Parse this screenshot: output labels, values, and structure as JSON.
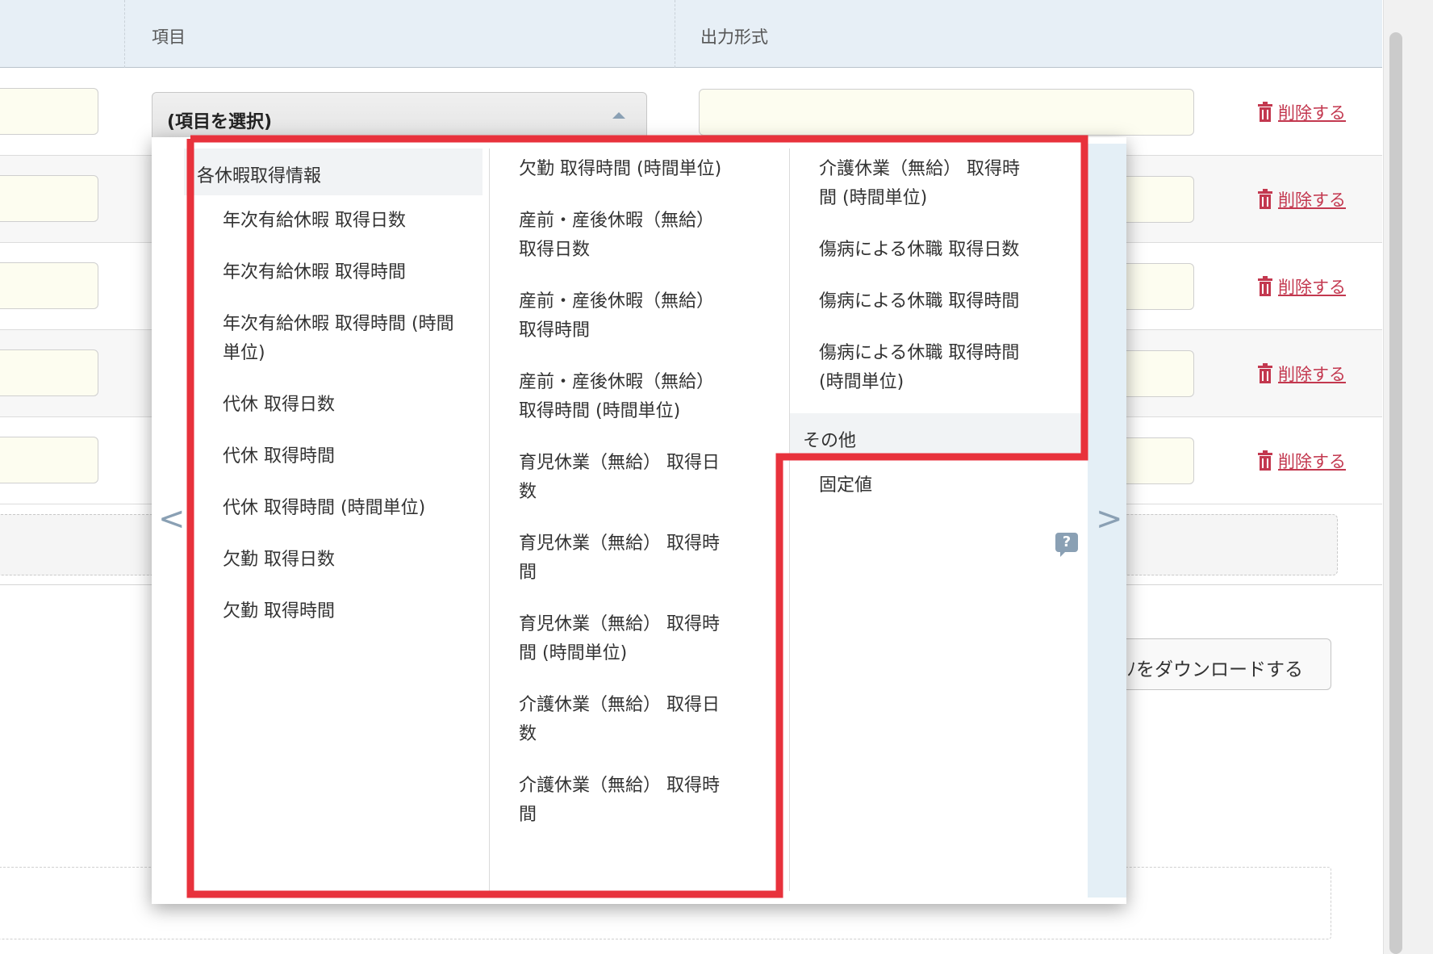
{
  "table_header": {
    "col_item": "項目",
    "col_format": "出力形式"
  },
  "rows": [
    {
      "delete_label": "削除する"
    },
    {
      "delete_label": "削除する"
    },
    {
      "delete_label": "削除する"
    },
    {
      "delete_label": "削除する"
    },
    {
      "delete_label": "削除する"
    }
  ],
  "select": {
    "value": "(項目を選択)"
  },
  "download_button": {
    "label": "ﾉをダウンロードする"
  },
  "dropdown": {
    "nav_prev": "<",
    "nav_next": ">",
    "group1_header": "各休暇取得情報",
    "col1_items": [
      "年次有給休暇 取得日数",
      "年次有給休暇 取得時間",
      "年次有給休暇 取得時間 (時間単位)",
      "代休 取得日数",
      "代休 取得時間",
      "代休 取得時間 (時間単位)",
      "欠勤 取得日数",
      "欠勤 取得時間"
    ],
    "col2_items": [
      "欠勤 取得時間 (時間単位)",
      "産前・産後休暇（無給） 取得日数",
      "産前・産後休暇（無給） 取得時間",
      "産前・産後休暇（無給） 取得時間 (時間単位)",
      "育児休業（無給） 取得日数",
      "育児休業（無給） 取得時間",
      "育児休業（無給） 取得時間 (時間単位)",
      "介護休業（無給） 取得日数",
      "介護休業（無給） 取得時間"
    ],
    "col3_items": [
      "介護休業（無給） 取得時間 (時間単位)",
      "傷病による休職 取得日数",
      "傷病による休職 取得時間",
      "傷病による休職 取得時間 (時間単位)"
    ],
    "group2_header": "その他",
    "group2_items": [
      "固定値"
    ],
    "help_icon_glyph": "?"
  },
  "colors": {
    "annotation": "#e8323c",
    "delete_link": "#c3384f",
    "header_bg": "#e7eff6",
    "input_bg": "#fdfdf0"
  },
  "icons": [
    "trash-icon",
    "help-icon",
    "chevron-left-icon",
    "chevron-right-icon",
    "caret-up-icon"
  ]
}
